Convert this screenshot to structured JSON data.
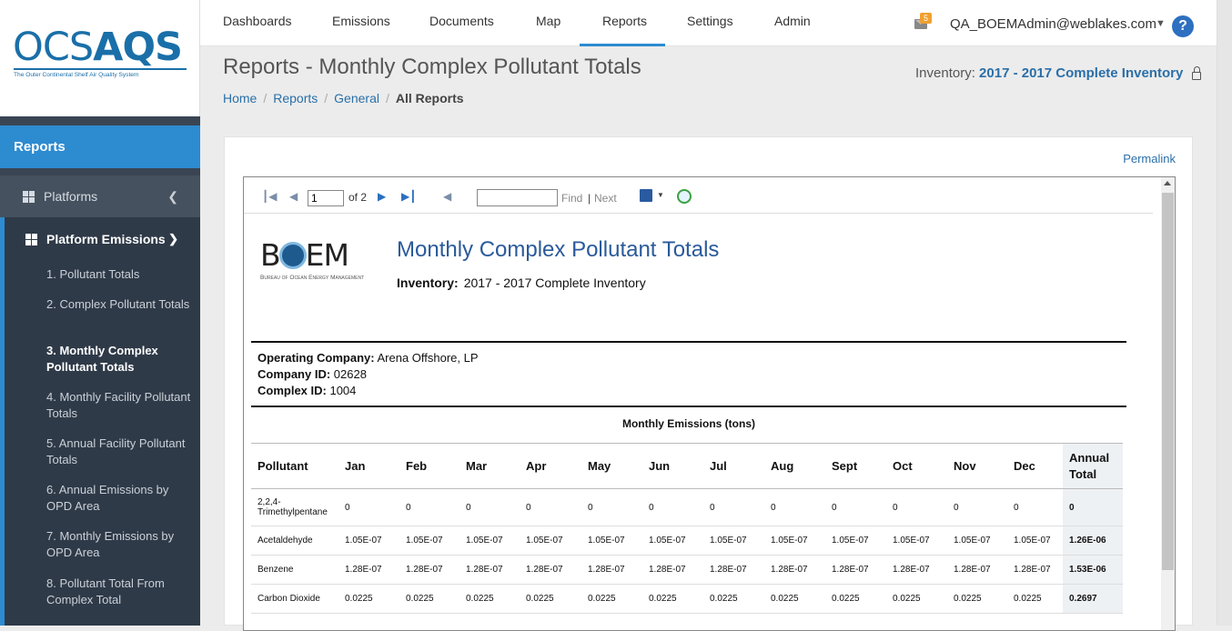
{
  "logo": {
    "text_light": "OCS",
    "text_bold": "AQS",
    "tagline": "The Outer Continental Shelf Air Quality System"
  },
  "sidebar": {
    "title": "Reports",
    "platforms_label": "Platforms",
    "platform_emissions_label": "Platform Emissions",
    "items": [
      {
        "label": "1. Pollutant Totals"
      },
      {
        "label": "2. Complex Pollutant Totals"
      },
      {
        "label": "3. Monthly Complex Pollutant Totals"
      },
      {
        "label": "4. Monthly Facility Pollutant Totals"
      },
      {
        "label": "5. Annual Facility Pollutant Totals"
      },
      {
        "label": "6. Annual Emissions by OPD Area"
      },
      {
        "label": "7. Monthly Emissions by OPD Area"
      },
      {
        "label": "8. Pollutant Total From Complex Total"
      }
    ]
  },
  "nav": [
    {
      "label": "Dashboards"
    },
    {
      "label": "Emissions"
    },
    {
      "label": "Documents"
    },
    {
      "label": "Map"
    },
    {
      "label": "Reports"
    },
    {
      "label": "Settings"
    },
    {
      "label": "Admin"
    }
  ],
  "user": {
    "email": "QA_BOEMAdmin@weblakes.com",
    "mail_count": "5",
    "help": "?"
  },
  "page": {
    "title": "Reports - Monthly Complex Pollutant Totals",
    "breadcrumbs": [
      "Home",
      "Reports",
      "General",
      "All Reports"
    ],
    "inventory_label": "Inventory:",
    "inventory_value": "2017 - 2017 Complete Inventory",
    "permalink": "Permalink"
  },
  "toolbar": {
    "page_value": "1",
    "of_pages": "of 2",
    "find": "Find",
    "pipe": "|",
    "next": "Next"
  },
  "report": {
    "logo_text": "BOEM",
    "logo_sub": "Bureau of Ocean Energy Management",
    "title": "Monthly Complex Pollutant Totals",
    "inventory_label": "Inventory:",
    "inventory_value": "2017 - 2017 Complete Inventory",
    "operating_company_label": "Operating Company:",
    "operating_company": "Arena Offshore, LP",
    "company_id_label": "Company ID:",
    "company_id": "02628",
    "complex_id_label": "Complex ID:",
    "complex_id": "1004",
    "monthly_header": "Monthly Emissions (tons)",
    "columns": [
      "Pollutant",
      "Jan",
      "Feb",
      "Mar",
      "Apr",
      "May",
      "Jun",
      "Jul",
      "Aug",
      "Sept",
      "Oct",
      "Nov",
      "Dec",
      "Annual Total"
    ],
    "rows": [
      [
        "2,2,4-Trimethylpentane",
        "0",
        "0",
        "0",
        "0",
        "0",
        "0",
        "0",
        "0",
        "0",
        "0",
        "0",
        "0",
        "0"
      ],
      [
        "Acetaldehyde",
        "1.05E-07",
        "1.05E-07",
        "1.05E-07",
        "1.05E-07",
        "1.05E-07",
        "1.05E-07",
        "1.05E-07",
        "1.05E-07",
        "1.05E-07",
        "1.05E-07",
        "1.05E-07",
        "1.05E-07",
        "1.26E-06"
      ],
      [
        "Benzene",
        "1.28E-07",
        "1.28E-07",
        "1.28E-07",
        "1.28E-07",
        "1.28E-07",
        "1.28E-07",
        "1.28E-07",
        "1.28E-07",
        "1.28E-07",
        "1.28E-07",
        "1.28E-07",
        "1.28E-07",
        "1.53E-06"
      ],
      [
        "Carbon Dioxide",
        "0.0225",
        "0.0225",
        "0.0225",
        "0.0225",
        "0.0225",
        "0.0225",
        "0.0225",
        "0.0225",
        "0.0225",
        "0.0225",
        "0.0225",
        "0.0225",
        "0.2697"
      ]
    ]
  }
}
